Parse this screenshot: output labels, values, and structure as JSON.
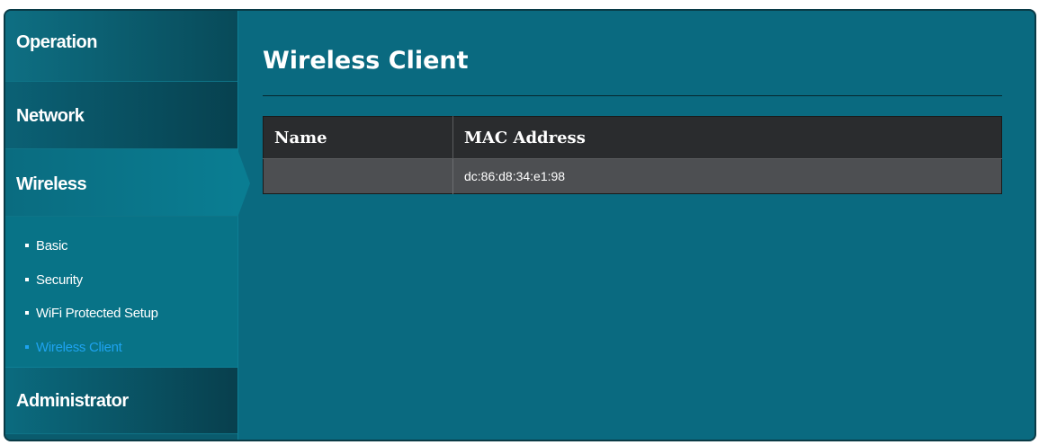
{
  "sidebar": {
    "items": [
      {
        "label": "Operation"
      },
      {
        "label": "Network"
      },
      {
        "label": "Wireless"
      },
      {
        "label": "Administrator"
      }
    ],
    "wireless_submenu": [
      {
        "label": "Basic"
      },
      {
        "label": "Security"
      },
      {
        "label": "WiFi Protected Setup"
      },
      {
        "label": "Wireless Client",
        "active": true
      }
    ]
  },
  "main": {
    "title": "Wireless Client",
    "table": {
      "headers": [
        "Name",
        "MAC Address"
      ],
      "rows": [
        {
          "name": "",
          "mac": "dc:86:d8:34:e1:98"
        }
      ]
    }
  },
  "colors": {
    "background": "#0a6a80",
    "active_link": "#1ea3f0",
    "table_header": "#2a2c2e",
    "table_row": "#4d4f52"
  }
}
